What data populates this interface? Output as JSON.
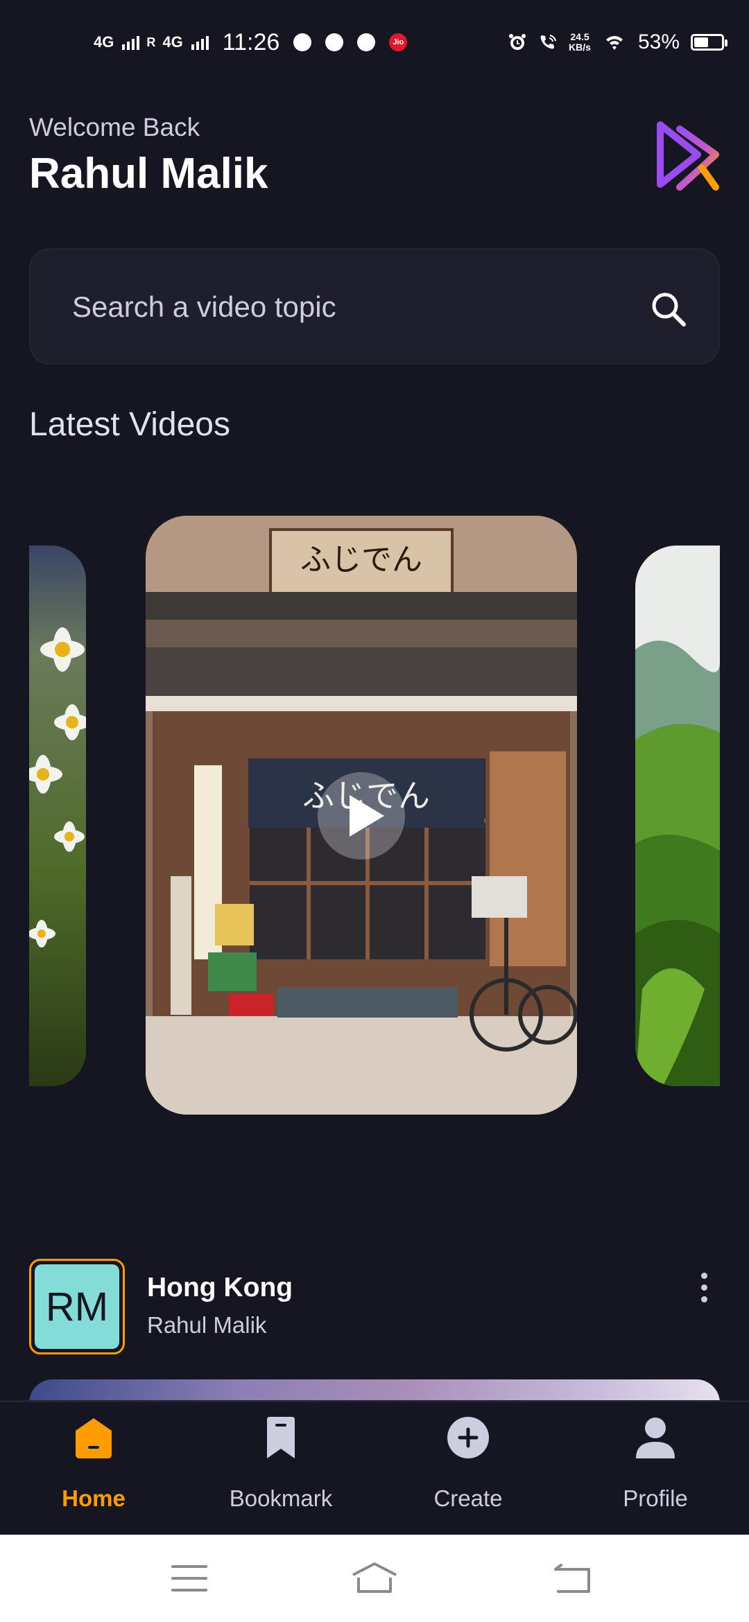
{
  "status_bar": {
    "network_1": "4G",
    "roaming": "R",
    "network_2": "4G",
    "time": "11:26",
    "jio_label": "Jio",
    "speed_value": "24.5",
    "speed_unit": "KB/s",
    "battery": "53%",
    "battery_level": 0.53
  },
  "header": {
    "welcome": "Welcome Back",
    "username": "Rahul Malik"
  },
  "search": {
    "placeholder": "Search a video topic",
    "value": ""
  },
  "section_title": "Latest Videos",
  "video_item": {
    "avatar_initials": "RM",
    "title": "Hong Kong",
    "author": "Rahul Malik"
  },
  "tabs": [
    {
      "label": "Home",
      "icon": "home-icon",
      "active": true
    },
    {
      "label": "Bookmark",
      "icon": "bookmark-icon",
      "active": false
    },
    {
      "label": "Create",
      "icon": "plus-circle-icon",
      "active": false
    },
    {
      "label": "Profile",
      "icon": "user-icon",
      "active": false
    }
  ],
  "colors": {
    "background": "#161622",
    "accent": "#ff9c01",
    "field": "#1e1e2d",
    "muted_text": "#cdcde0",
    "avatar_bg": "#83dcd8",
    "logo_gradient": [
      "#9b4cf0",
      "#ff9c01"
    ]
  }
}
